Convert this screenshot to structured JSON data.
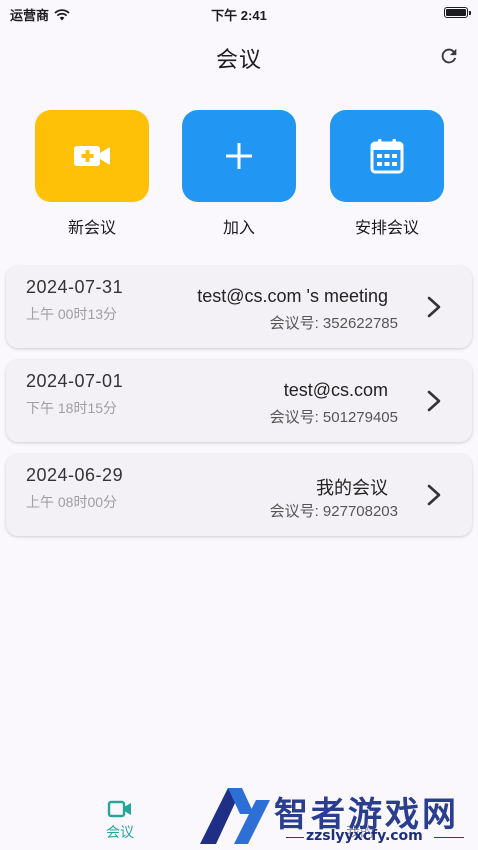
{
  "status_bar": {
    "carrier": "运营商",
    "time": "下午 2:41"
  },
  "header": {
    "title": "会议"
  },
  "actions": [
    {
      "label": "新会议",
      "icon": "video-plus-icon",
      "color": "#ffc107"
    },
    {
      "label": "加入",
      "icon": "plus-icon",
      "color": "#2196f3"
    },
    {
      "label": "安排会议",
      "icon": "calendar-icon",
      "color": "#2196f3"
    }
  ],
  "meetings": [
    {
      "date": "2024-07-31",
      "time": "上午 00时13分",
      "title": "test@cs.com 's meeting",
      "number": "会议号: 352622785"
    },
    {
      "date": "2024-07-01",
      "time": "下午 18时15分",
      "title": "test@cs.com",
      "number": "会议号: 501279405"
    },
    {
      "date": "2024-06-29",
      "time": "上午 08时00分",
      "title": "我的会议",
      "number": "会议号: 927708203"
    }
  ],
  "tab_bar": {
    "tabs": [
      {
        "label": "会议",
        "active": true,
        "icon": "video-camera-icon"
      },
      {
        "label": "我的",
        "active": false
      }
    ],
    "active_color": "#26a69a"
  },
  "watermark": {
    "text": "智者游戏网",
    "url": "zzslyyxcfy.com"
  }
}
